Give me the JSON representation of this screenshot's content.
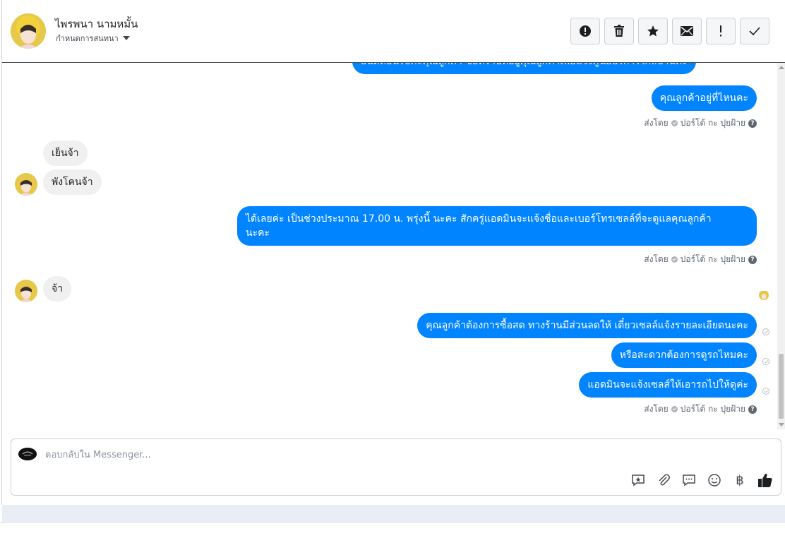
{
  "header": {
    "contact_name": "ไพรพนา นามหมั้น",
    "assign_label": "กำหนดการสนทนา",
    "actions": [
      {
        "name": "spam-button",
        "icon": "alert-icon"
      },
      {
        "name": "delete-button",
        "icon": "trash-icon"
      },
      {
        "name": "star-button",
        "icon": "star-icon"
      },
      {
        "name": "mark-unread-button",
        "icon": "envelope-icon"
      },
      {
        "name": "follow-up-button",
        "icon": "exclamation-icon"
      },
      {
        "name": "mark-done-button",
        "icon": "check-icon"
      }
    ]
  },
  "messages": {
    "m0": "ยินดีต้อนรับค่ะคุณลูกค้า ขอทราบที่อยู่คุณลูกค้าเพื่อแจ้งศูนย์บริการใกล้บ้านค่ะ",
    "m1": "คุณลูกค้าอยู่ที่ไหนคะ",
    "m2": "เย็นจ้า",
    "m3": "พังโคนจ้า",
    "m4_line1": "ได้เลยค่ะ เป็นช่วงประมาณ 17.00 น. พรุ่งนี้ นะคะ สักครู่แอดมินจะแจ้งชื่อและเบอร์โทรเซลล์ที่จะดูแลคุณลูกค้า",
    "m4_line2": "นะคะ",
    "m5": "จ้า",
    "m6": "คุณลูกค้าต้องการซื้อสด ทางร้านมีส่วนลดให้ เดี๋ยวเซลล์แจ้งรายละเอียดนะคะ",
    "m7": "หรือสะดวกต้องการดูรถไหมคะ",
    "m8": "แอดมินจะแจ้งเซลส์ให้เอารถไปให้ดูค่ะ"
  },
  "sent_by": {
    "prefix": "ส่งโดย",
    "name": "ปอร์โต้ กะ ปุยฝ้าย"
  },
  "composer": {
    "placeholder": "ตอบกลับใน Messenger...",
    "currency_symbol": "฿"
  },
  "colors": {
    "outgoing_bubble": "#0084ff",
    "incoming_bubble": "#f0f0f0"
  }
}
